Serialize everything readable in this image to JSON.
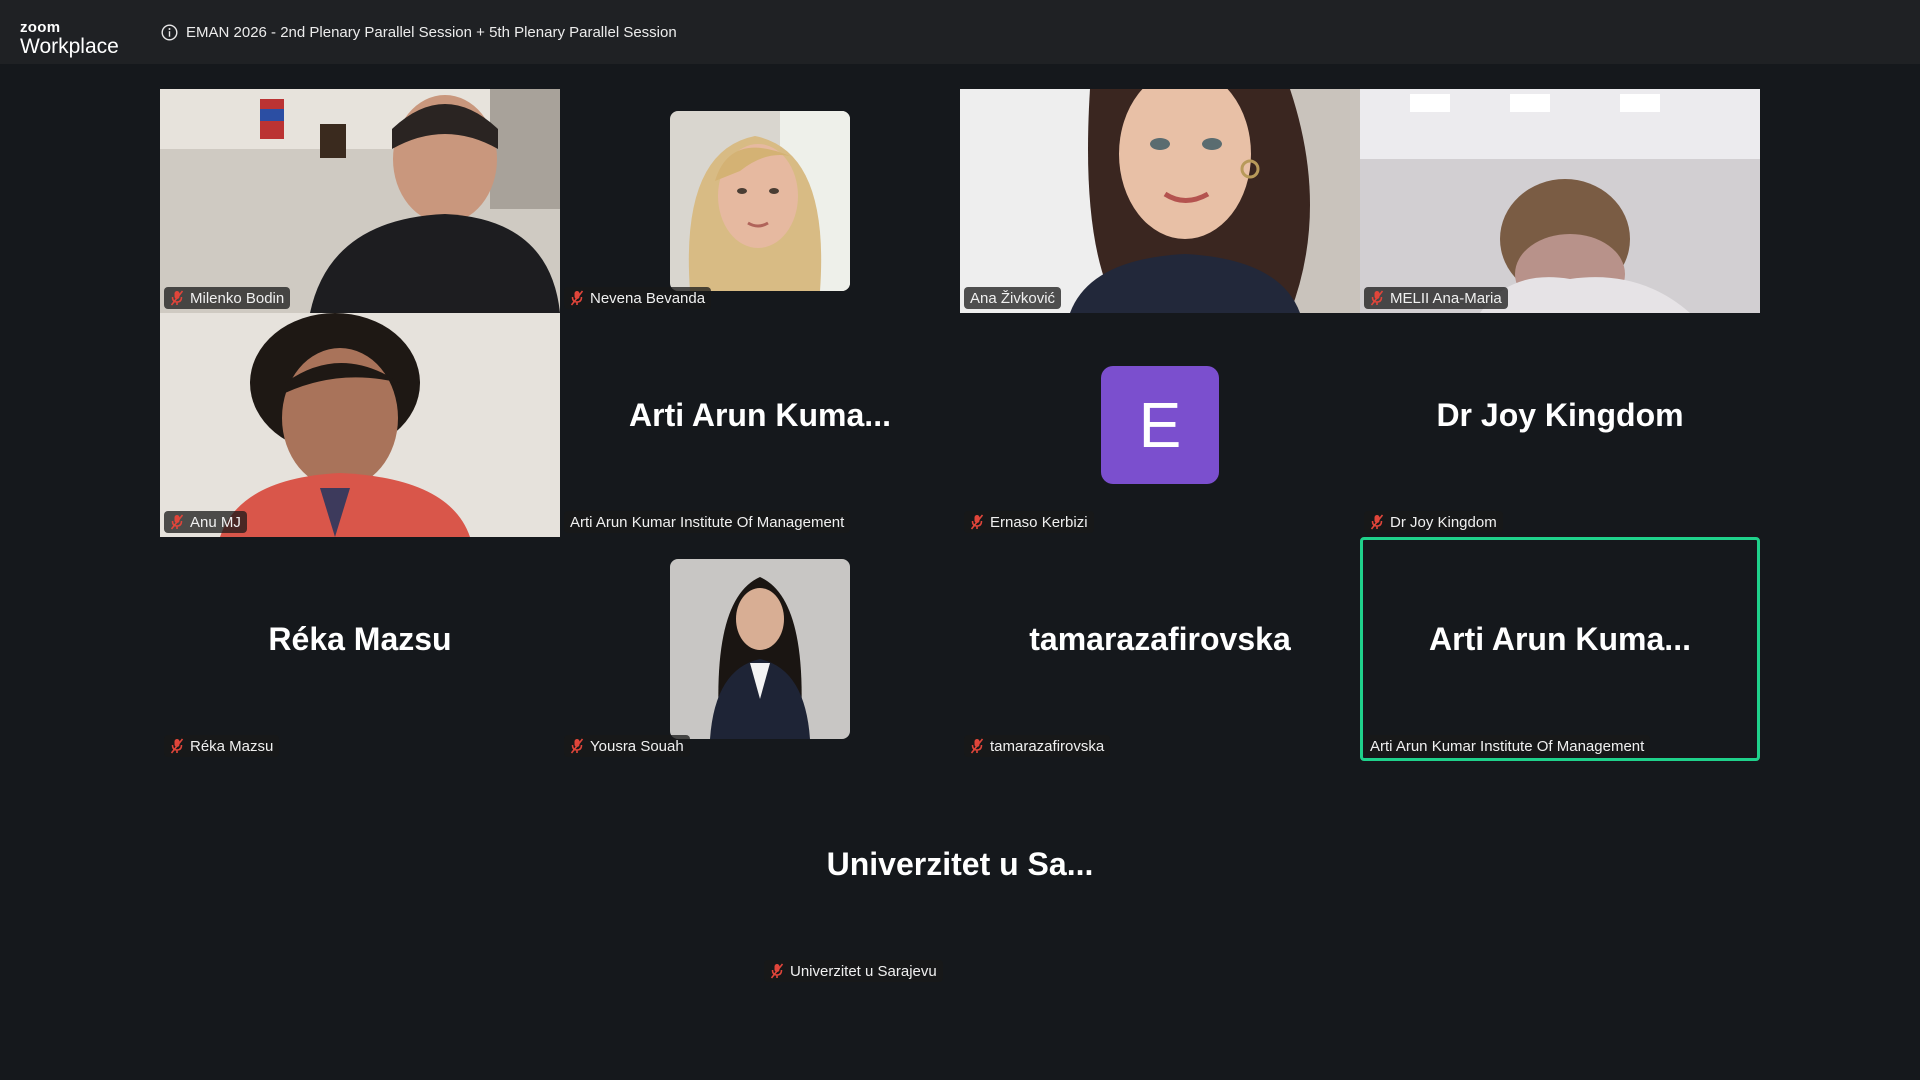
{
  "app": {
    "logo_small": "zoom",
    "logo_big": "Workplace"
  },
  "meeting": {
    "title": "EMAN 2026 - 2nd Plenary Parallel Session + 5th Plenary Parallel Session"
  },
  "icons": {
    "info": "info-circle-icon",
    "mic_muted": "mic-muted-icon"
  },
  "colors": {
    "active_speaker": "#1fd18b",
    "avatar_bg": "#7b4fce",
    "muted_icon": "#e0453a"
  },
  "tiles": [
    {
      "label": "Milenko Bodin",
      "muted": true,
      "type": "video"
    },
    {
      "label": "Nevena Bevanda",
      "muted": true,
      "type": "picture"
    },
    {
      "label": "Ana Živković",
      "muted": false,
      "type": "video"
    },
    {
      "label": "MELII Ana-Maria",
      "muted": true,
      "type": "video"
    },
    {
      "label": "Anu MJ",
      "muted": true,
      "type": "video"
    },
    {
      "display_name": "Arti Arun Kuma...",
      "label": "Arti Arun Kumar Institute Of Management",
      "muted": false,
      "type": "name"
    },
    {
      "avatar_letter": "E",
      "label": "Ernaso Kerbizi",
      "muted": true,
      "type": "avatar"
    },
    {
      "display_name": "Dr Joy Kingdom",
      "label": "Dr Joy Kingdom",
      "muted": true,
      "type": "name"
    },
    {
      "display_name": "Réka Mazsu",
      "label": "Réka Mazsu",
      "muted": true,
      "type": "name"
    },
    {
      "label": "Yousra Souah",
      "muted": true,
      "type": "picture"
    },
    {
      "display_name": "tamarazafirovska",
      "label": "tamarazafirovska",
      "muted": true,
      "type": "name"
    },
    {
      "display_name": "Arti Arun Kuma...",
      "label": "Arti Arun Kumar Institute Of Management",
      "muted": false,
      "type": "name",
      "active_speaker": true
    },
    {
      "display_name": "Univerzitet u Sa...",
      "label": "Univerzitet u Sarajevu",
      "muted": true,
      "type": "name"
    }
  ]
}
